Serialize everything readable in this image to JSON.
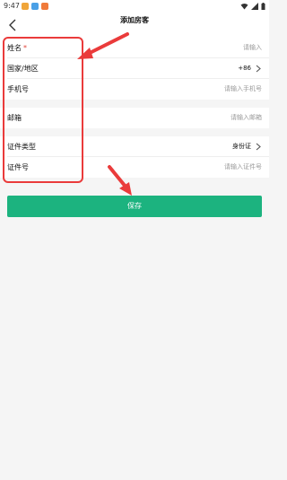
{
  "status_bar": {
    "time": "9:47",
    "notification_icons": [
      "chat-icon",
      "message-icon",
      "app-icon"
    ],
    "system_icons": [
      "wifi-icon",
      "signal-icon",
      "battery-icon"
    ]
  },
  "header": {
    "title": "添加房客"
  },
  "form": {
    "name": {
      "label": "姓名",
      "required_mark": "*",
      "placeholder": "请输入"
    },
    "country": {
      "label": "国家/地区",
      "value": "+86"
    },
    "phone": {
      "label": "手机号",
      "placeholder": "请输入手机号"
    },
    "email": {
      "label": "邮箱",
      "placeholder": "请输入邮箱"
    },
    "id_type": {
      "label": "证件类型",
      "value": "身份证"
    },
    "id_number": {
      "label": "证件号",
      "placeholder": "请输入证件号"
    }
  },
  "save_button": {
    "label": "保存"
  },
  "colors": {
    "accent": "#1cb37f",
    "annotation": "#ea3b3b",
    "required": "#e0453a"
  }
}
